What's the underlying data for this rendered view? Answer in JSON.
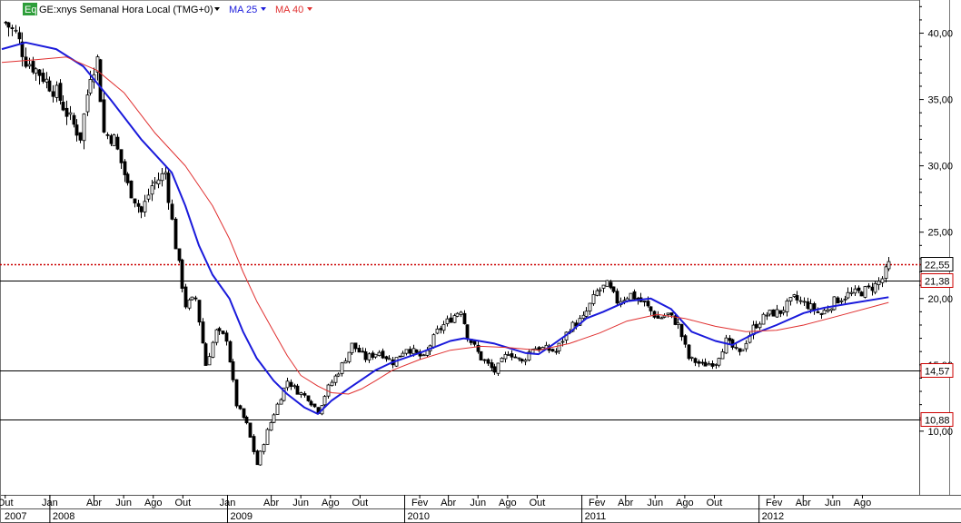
{
  "header": {
    "badge": "Eq",
    "title": "GE:xnys Semanal Hora Local (TMG+0)",
    "ma25_label": "MA 25",
    "ma40_label": "MA 40",
    "colors": {
      "badge": "#2e9e3a",
      "ma25": "#1a1adb",
      "ma40": "#e03030",
      "resistance": "#cc0000"
    }
  },
  "chart_data": {
    "type": "candlestick",
    "title": "GE:xnys Semanal Hora Local (TMG+0)",
    "ylim": [
      5.2,
      42.5
    ],
    "y_ticks": [
      "10,00",
      "15,00",
      "20,00",
      "25,00",
      "30,00",
      "35,00",
      "40,00"
    ],
    "y_tick_values": [
      10,
      15,
      20,
      25,
      30,
      35,
      40
    ],
    "x_range": [
      "2007-09-24",
      "2012-11-26"
    ],
    "month_ticks": [
      {
        "date": "2007-10-01",
        "label": "Out"
      },
      {
        "date": "2008-01-01",
        "label": "Jan"
      },
      {
        "date": "2008-04-01",
        "label": "Abr"
      },
      {
        "date": "2008-06-01",
        "label": "Jun"
      },
      {
        "date": "2008-08-01",
        "label": "Ago"
      },
      {
        "date": "2008-10-01",
        "label": "Out"
      },
      {
        "date": "2009-01-01",
        "label": "Jan"
      },
      {
        "date": "2009-04-01",
        "label": "Abr"
      },
      {
        "date": "2009-06-01",
        "label": "Jun"
      },
      {
        "date": "2009-08-01",
        "label": "Ago"
      },
      {
        "date": "2009-10-01",
        "label": "Out"
      },
      {
        "date": "2010-02-01",
        "label": "Fev"
      },
      {
        "date": "2010-04-01",
        "label": "Abr"
      },
      {
        "date": "2010-06-01",
        "label": "Jun"
      },
      {
        "date": "2010-08-01",
        "label": "Ago"
      },
      {
        "date": "2010-10-01",
        "label": "Out"
      },
      {
        "date": "2011-02-01",
        "label": "Fev"
      },
      {
        "date": "2011-04-01",
        "label": "Abr"
      },
      {
        "date": "2011-06-01",
        "label": "Jun"
      },
      {
        "date": "2011-08-01",
        "label": "Ago"
      },
      {
        "date": "2011-10-01",
        "label": "Out"
      },
      {
        "date": "2012-02-01",
        "label": "Fev"
      },
      {
        "date": "2012-04-01",
        "label": "Abr"
      },
      {
        "date": "2012-06-01",
        "label": "Jun"
      },
      {
        "date": "2012-08-01",
        "label": "Ago"
      }
    ],
    "year_ticks": [
      {
        "date": "2007-09-24",
        "label": "2007"
      },
      {
        "date": "2008-01-01",
        "label": "2008"
      },
      {
        "date": "2009-01-01",
        "label": "2009"
      },
      {
        "date": "2010-01-01",
        "label": "2010"
      },
      {
        "date": "2011-01-01",
        "label": "2011"
      },
      {
        "date": "2012-01-01",
        "label": "2012"
      }
    ],
    "horizontal_lines": [
      {
        "value": 22.55,
        "label": "22,55",
        "style": "dotted",
        "color": "#cc0000"
      },
      {
        "value": 21.38,
        "label": "21,38",
        "style": "solid",
        "color": "#000000"
      },
      {
        "value": 14.57,
        "label": "14,57",
        "style": "solid",
        "color": "#000000"
      },
      {
        "value": 10.88,
        "label": "10,88",
        "style": "solid",
        "color": "#000000"
      }
    ],
    "price_path": [
      [
        "2007-10-01",
        40.8
      ],
      [
        "2007-10-22",
        40.0
      ],
      [
        "2007-11-12",
        38.0
      ],
      [
        "2007-12-10",
        37.0
      ],
      [
        "2008-01-14",
        35.5
      ],
      [
        "2008-02-11",
        33.5
      ],
      [
        "2008-03-03",
        32.2
      ],
      [
        "2008-03-24",
        37.0
      ],
      [
        "2008-04-07",
        38.0
      ],
      [
        "2008-04-21",
        32.5
      ],
      [
        "2008-05-12",
        32.0
      ],
      [
        "2008-06-09",
        28.5
      ],
      [
        "2008-07-07",
        26.5
      ],
      [
        "2008-07-28",
        28.5
      ],
      [
        "2008-08-25",
        29.5
      ],
      [
        "2008-09-15",
        24.0
      ],
      [
        "2008-10-06",
        19.5
      ],
      [
        "2008-10-27",
        20.0
      ],
      [
        "2008-11-17",
        15.0
      ],
      [
        "2008-12-08",
        17.5
      ],
      [
        "2008-12-29",
        17.0
      ],
      [
        "2009-01-19",
        12.0
      ],
      [
        "2009-02-09",
        10.5
      ],
      [
        "2009-03-02",
        7.5
      ],
      [
        "2009-03-23",
        10.0
      ],
      [
        "2009-04-13",
        12.0
      ],
      [
        "2009-05-04",
        13.8
      ],
      [
        "2009-05-25",
        13.0
      ],
      [
        "2009-06-15",
        12.5
      ],
      [
        "2009-07-06",
        11.5
      ],
      [
        "2009-07-27",
        13.3
      ],
      [
        "2009-08-17",
        14.5
      ],
      [
        "2009-09-14",
        16.5
      ],
      [
        "2009-10-12",
        15.5
      ],
      [
        "2009-11-09",
        16.0
      ],
      [
        "2009-12-07",
        15.2
      ],
      [
        "2010-01-04",
        16.3
      ],
      [
        "2010-02-08",
        15.5
      ],
      [
        "2010-03-08",
        17.5
      ],
      [
        "2010-04-05",
        18.5
      ],
      [
        "2010-04-26",
        19.2
      ],
      [
        "2010-05-10",
        17.2
      ],
      [
        "2010-06-07",
        15.5
      ],
      [
        "2010-07-05",
        14.5
      ],
      [
        "2010-08-02",
        16.0
      ],
      [
        "2010-08-30",
        15.2
      ],
      [
        "2010-09-20",
        16.3
      ],
      [
        "2010-10-18",
        16.2
      ],
      [
        "2010-11-08",
        16.0
      ],
      [
        "2010-12-06",
        17.8
      ],
      [
        "2011-01-03",
        18.5
      ],
      [
        "2011-01-31",
        20.5
      ],
      [
        "2011-02-21",
        21.0
      ],
      [
        "2011-03-14",
        19.8
      ],
      [
        "2011-04-11",
        20.3
      ],
      [
        "2011-05-09",
        19.6
      ],
      [
        "2011-06-06",
        18.5
      ],
      [
        "2011-06-27",
        18.8
      ],
      [
        "2011-07-18",
        18.0
      ],
      [
        "2011-08-08",
        15.5
      ],
      [
        "2011-09-05",
        15.0
      ],
      [
        "2011-10-03",
        15.2
      ],
      [
        "2011-10-24",
        16.8
      ],
      [
        "2011-11-21",
        15.8
      ],
      [
        "2011-12-19",
        17.8
      ],
      [
        "2012-01-16",
        18.8
      ],
      [
        "2012-02-13",
        19.0
      ],
      [
        "2012-03-12",
        20.0
      ],
      [
        "2012-04-09",
        19.5
      ],
      [
        "2012-05-07",
        18.8
      ],
      [
        "2012-06-04",
        19.8
      ],
      [
        "2012-07-02",
        20.3
      ],
      [
        "2012-07-30",
        20.5
      ],
      [
        "2012-08-27",
        21.0
      ],
      [
        "2012-09-10",
        21.5
      ],
      [
        "2012-09-24",
        22.55
      ]
    ],
    "series": [
      {
        "name": "MA 25",
        "color": "#1a1adb",
        "points": [
          [
            "2007-09-24",
            38.8
          ],
          [
            "2007-11-12",
            39.3
          ],
          [
            "2008-01-14",
            38.8
          ],
          [
            "2008-03-10",
            37.5
          ],
          [
            "2008-05-05",
            35.0
          ],
          [
            "2008-07-07",
            32.0
          ],
          [
            "2008-09-08",
            29.5
          ],
          [
            "2008-10-06",
            27.0
          ],
          [
            "2008-11-03",
            24.0
          ],
          [
            "2008-12-01",
            21.8
          ],
          [
            "2009-01-05",
            20.0
          ],
          [
            "2009-02-02",
            17.5
          ],
          [
            "2009-03-02",
            15.5
          ],
          [
            "2009-04-06",
            13.8
          ],
          [
            "2009-05-04",
            12.8
          ],
          [
            "2009-06-08",
            11.8
          ],
          [
            "2009-07-06",
            11.3
          ],
          [
            "2009-08-03",
            12.3
          ],
          [
            "2009-09-07",
            13.2
          ],
          [
            "2009-10-05",
            13.9
          ],
          [
            "2009-11-02",
            14.6
          ],
          [
            "2009-12-07",
            15.2
          ],
          [
            "2010-02-01",
            15.9
          ],
          [
            "2010-04-05",
            16.8
          ],
          [
            "2010-05-03",
            17.0
          ],
          [
            "2010-07-05",
            16.6
          ],
          [
            "2010-09-06",
            15.9
          ],
          [
            "2010-10-04",
            15.8
          ],
          [
            "2010-11-01",
            16.5
          ],
          [
            "2010-12-06",
            17.4
          ],
          [
            "2011-01-10",
            18.5
          ],
          [
            "2011-02-14",
            19.0
          ],
          [
            "2011-04-04",
            19.8
          ],
          [
            "2011-05-23",
            20.0
          ],
          [
            "2011-07-04",
            19.2
          ],
          [
            "2011-08-15",
            17.5
          ],
          [
            "2011-10-03",
            16.8
          ],
          [
            "2011-11-07",
            16.5
          ],
          [
            "2011-12-19",
            17.3
          ],
          [
            "2012-02-06",
            18.0
          ],
          [
            "2012-04-02",
            18.9
          ],
          [
            "2012-05-14",
            19.3
          ],
          [
            "2012-07-02",
            19.6
          ],
          [
            "2012-09-24",
            20.1
          ]
        ]
      },
      {
        "name": "MA 40",
        "color": "#e03030",
        "points": [
          [
            "2007-09-24",
            37.8
          ],
          [
            "2007-12-03",
            38.0
          ],
          [
            "2008-02-04",
            38.2
          ],
          [
            "2008-04-07",
            37.2
          ],
          [
            "2008-06-02",
            35.5
          ],
          [
            "2008-08-04",
            32.5
          ],
          [
            "2008-10-06",
            30.0
          ],
          [
            "2008-12-01",
            27.0
          ],
          [
            "2009-01-05",
            24.5
          ],
          [
            "2009-02-02",
            22.0
          ],
          [
            "2009-03-02",
            19.8
          ],
          [
            "2009-04-06",
            17.5
          ],
          [
            "2009-05-04",
            15.7
          ],
          [
            "2009-06-01",
            14.2
          ],
          [
            "2009-07-06",
            13.4
          ],
          [
            "2009-08-03",
            12.9
          ],
          [
            "2009-09-07",
            12.8
          ],
          [
            "2009-10-05",
            13.2
          ],
          [
            "2009-11-02",
            13.8
          ],
          [
            "2009-12-07",
            14.6
          ],
          [
            "2010-02-01",
            15.4
          ],
          [
            "2010-04-05",
            16.1
          ],
          [
            "2010-06-07",
            16.4
          ],
          [
            "2010-08-02",
            16.3
          ],
          [
            "2010-10-04",
            16.1
          ],
          [
            "2010-12-06",
            16.6
          ],
          [
            "2011-02-07",
            17.4
          ],
          [
            "2011-04-04",
            18.3
          ],
          [
            "2011-06-06",
            18.8
          ],
          [
            "2011-08-01",
            18.5
          ],
          [
            "2011-10-03",
            17.9
          ],
          [
            "2011-12-05",
            17.5
          ],
          [
            "2012-02-06",
            17.6
          ],
          [
            "2012-04-02",
            18.0
          ],
          [
            "2012-06-04",
            18.6
          ],
          [
            "2012-09-24",
            19.7
          ]
        ]
      }
    ],
    "legend": "top-left",
    "grid": false
  }
}
